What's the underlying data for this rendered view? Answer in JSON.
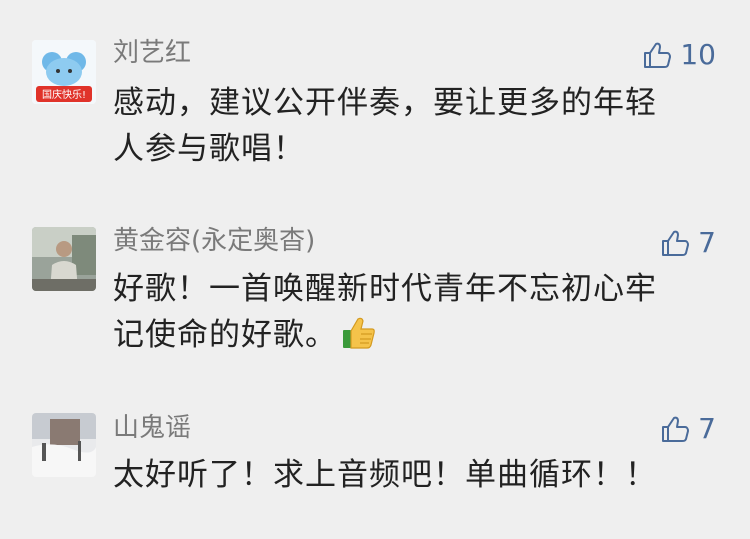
{
  "comments": [
    {
      "name": "刘艺红",
      "likes": "10",
      "avatar_badge": "国庆快乐!",
      "lines": [
        "感动，建议公开伴奏，要让更多的年轻",
        "人参与歌唱！"
      ]
    },
    {
      "name": "黄金容(永定奥杳)",
      "likes": "7",
      "lines": [
        "好歌！一首唤醒新时代青年不忘初心牢",
        "记使命的好歌。"
      ],
      "emoji": "thumbs-up-emoji"
    },
    {
      "name": "山鬼谣",
      "likes": "7",
      "lines": [
        "太好听了！求上音频吧！单曲循环！！"
      ]
    }
  ],
  "icons": {
    "like": "thumbs-up-outline-icon"
  },
  "colors": {
    "background": "#efefef",
    "name": "#7a7a7a",
    "like": "#4a6b9a",
    "text": "#222222"
  }
}
